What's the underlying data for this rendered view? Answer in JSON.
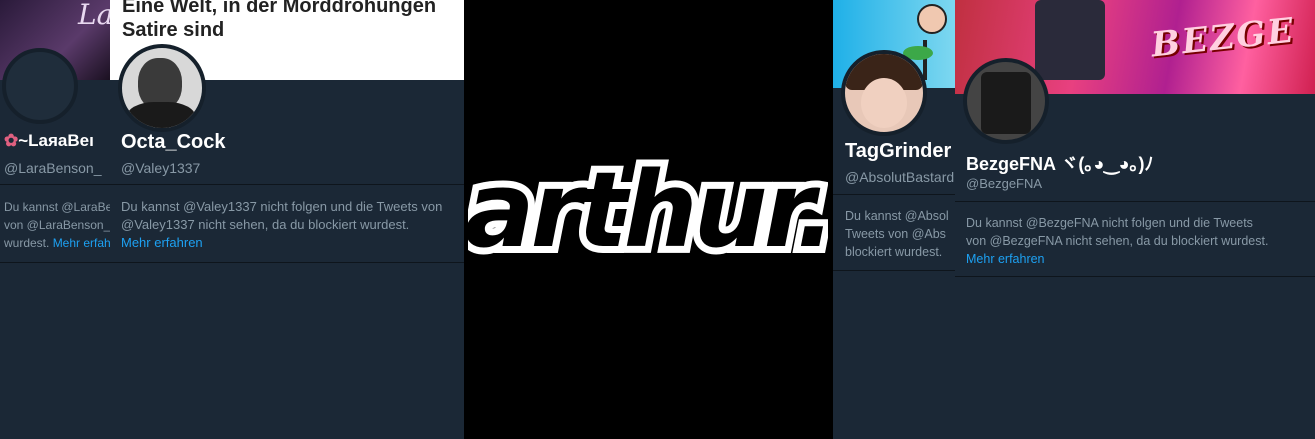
{
  "panels": {
    "lara": {
      "name": "~LaяaBeı",
      "handle": "@LaraBenson_",
      "message_lines": [
        "Du kannst @LaraBe",
        "von @LaraBenson_",
        "wurdest. "
      ],
      "more": "Mehr erfah",
      "banner_text": "La"
    },
    "octa": {
      "headline_line1": "Eine Welt, in der Morddrohungen",
      "headline_line2": "Satire sind",
      "name": "Octa_Cock",
      "handle": "@Valey1337",
      "message": "Du kannst @Valey1337 nicht folgen und die Tweets von @Valey1337 nicht sehen, da du blockiert wurdest.",
      "more": "Mehr erfahren"
    },
    "tag": {
      "name": "TagGrinder",
      "handle": "@AbsolutBastard",
      "message_lines": [
        "Du kannst @Absol",
        "Tweets von @Abs",
        "blockiert wurdest."
      ]
    },
    "bezge": {
      "name": "BezgeFNA ヾ(｡◕‿◕｡)ﾉ",
      "handle": "@BezgeFNA",
      "message": "Du kannst @BezgeFNA nicht folgen und die Tweets von @BezgeFNA nicht sehen, da du blockiert wurdest. ",
      "more": "Mehr erfahren",
      "banner_text": "BEZGE"
    }
  },
  "center": {
    "logo": "arthur."
  },
  "colors": {
    "panel_bg": "#1b2836",
    "link": "#1da1f2",
    "muted": "#8899a6"
  }
}
